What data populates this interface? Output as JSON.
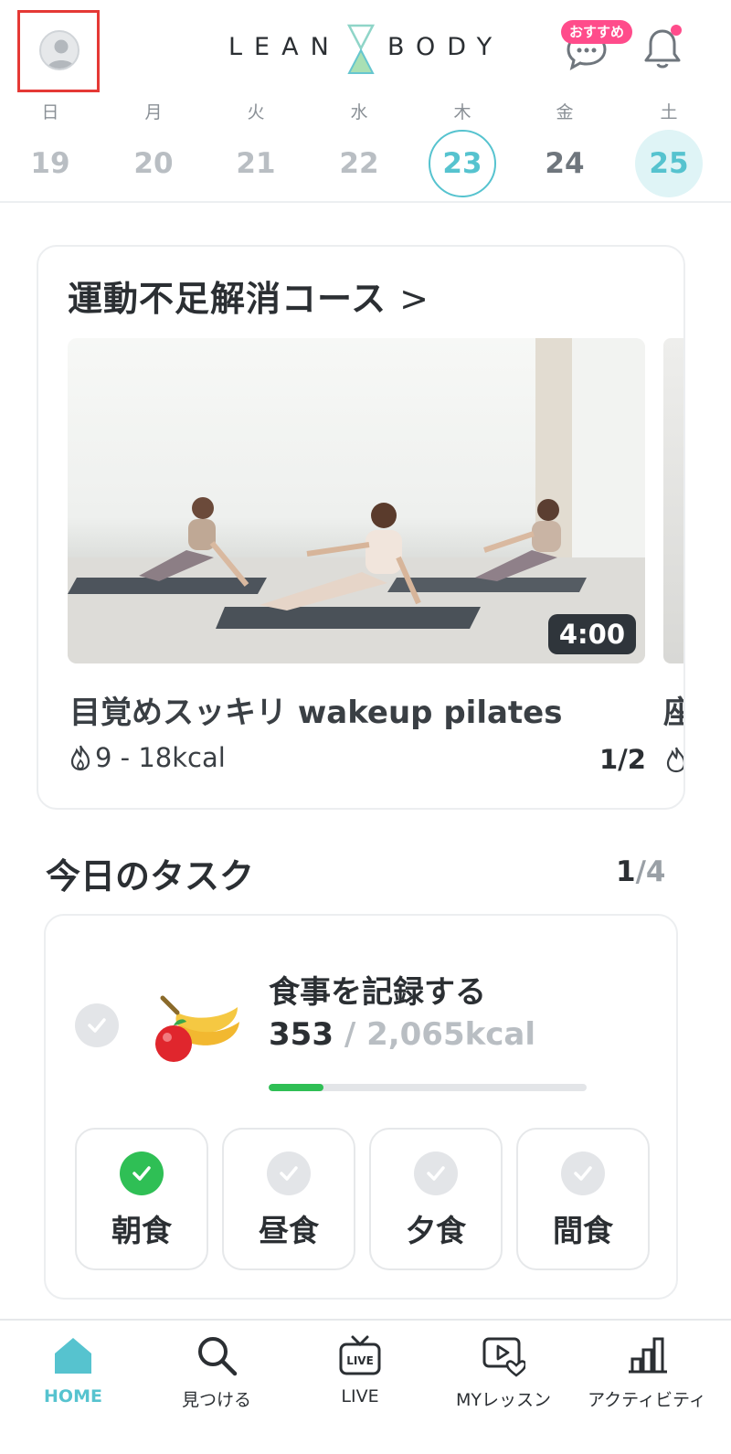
{
  "header": {
    "logo_left": "LEAN",
    "logo_right": "BODY",
    "recommend_badge": "おすすめ"
  },
  "week": [
    {
      "weekday": "日",
      "date": "19",
      "state": "past"
    },
    {
      "weekday": "月",
      "date": "20",
      "state": "past"
    },
    {
      "weekday": "火",
      "date": "21",
      "state": "past"
    },
    {
      "weekday": "水",
      "date": "22",
      "state": "past"
    },
    {
      "weekday": "木",
      "date": "23",
      "state": "selected"
    },
    {
      "weekday": "金",
      "date": "24",
      "state": "future"
    },
    {
      "weekday": "土",
      "date": "25",
      "state": "today"
    }
  ],
  "course": {
    "title": "運動不足解消コース",
    "chevron": ">",
    "video_title": "目覚めスッキリ wakeup pilates",
    "duration": "4:00",
    "kcal": "9 - 18kcal",
    "pager": "1/2",
    "next_title_peek": "座"
  },
  "tasks": {
    "title": "今日のタスク",
    "done": "1",
    "separator": "/",
    "total": "4",
    "meal_task": {
      "name": "食事を記録する",
      "current": "353",
      "goal": " / 2,065kcal",
      "progress_fraction": 0.171
    },
    "meals": [
      {
        "label": "朝食",
        "done": true
      },
      {
        "label": "昼食",
        "done": false
      },
      {
        "label": "夕食",
        "done": false
      },
      {
        "label": "間食",
        "done": false
      }
    ]
  },
  "nav": [
    {
      "label": "HOME",
      "icon": "home-icon",
      "active": true
    },
    {
      "label": "見つける",
      "icon": "search-icon",
      "active": false
    },
    {
      "label": "LIVE",
      "icon": "live-tv-icon",
      "active": false
    },
    {
      "label": "MYレッスン",
      "icon": "my-lesson-icon",
      "active": false
    },
    {
      "label": "アクティビティ",
      "icon": "activity-chart-icon",
      "active": false
    }
  ],
  "colors": {
    "accent": "#56c3cf",
    "success": "#2fbf55",
    "badge": "#ff4c8b",
    "highlight_box": "#e53935"
  }
}
